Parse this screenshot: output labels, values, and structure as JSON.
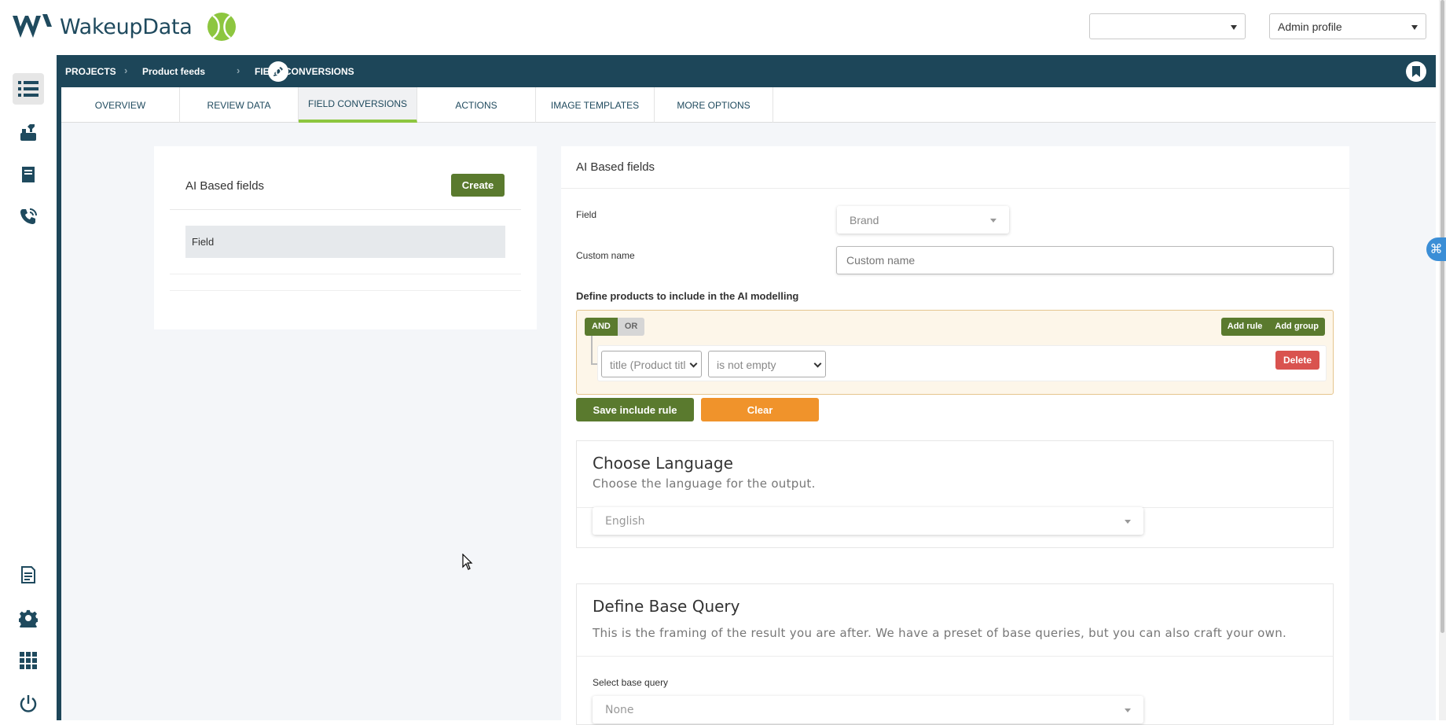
{
  "app": {
    "logo_text": "WakeupData",
    "colors": {
      "brand_dark": "#1d4659",
      "accent_green": "#5a7a2e",
      "tab_underline": "#8dc63f",
      "clear_orange": "#f0932b",
      "delete_red": "#d9534f"
    }
  },
  "header": {
    "project_select_value": "",
    "profile_select_value": "Admin profile"
  },
  "sidebar": {
    "icons": [
      "list-icon",
      "tools-icon",
      "book-icon",
      "phone-support-icon",
      "document-icon",
      "gear-icon",
      "apps-grid-icon",
      "power-icon"
    ]
  },
  "breadcrumb": {
    "items": [
      "PROJECTS",
      "Product feeds",
      "FIELD CONVERSIONS"
    ]
  },
  "tabs": [
    {
      "label": "OVERVIEW"
    },
    {
      "label": "REVIEW DATA"
    },
    {
      "label": "FIELD CONVERSIONS",
      "active": true
    },
    {
      "label": "ACTIONS"
    },
    {
      "label": "IMAGE TEMPLATES"
    },
    {
      "label": "MORE OPTIONS"
    }
  ],
  "left_card": {
    "title": "AI Based fields",
    "create_label": "Create",
    "field_row": "Field"
  },
  "right_card": {
    "title": "AI Based fields",
    "field_label": "Field",
    "field_value": "Brand",
    "custom_name_label": "Custom name",
    "custom_name_placeholder": "Custom name",
    "define_title": "Define products to include in the AI modelling",
    "query_builder": {
      "and_label": "AND",
      "or_label": "OR",
      "add_rule_label": "Add rule",
      "add_group_label": "Add group",
      "rule_field": "title (Product titl",
      "rule_operator": "is not empty",
      "delete_label": "Delete"
    },
    "save_label": "Save include rule",
    "clear_label": "Clear",
    "language": {
      "title": "Choose Language",
      "subtitle": "Choose the language for the output.",
      "value": "English"
    },
    "base_query": {
      "title": "Define Base Query",
      "subtitle": "This is the framing of the result you are after. We have a preset of base queries, but you can also craft your own.",
      "select_label": "Select base query",
      "value": "None"
    }
  }
}
